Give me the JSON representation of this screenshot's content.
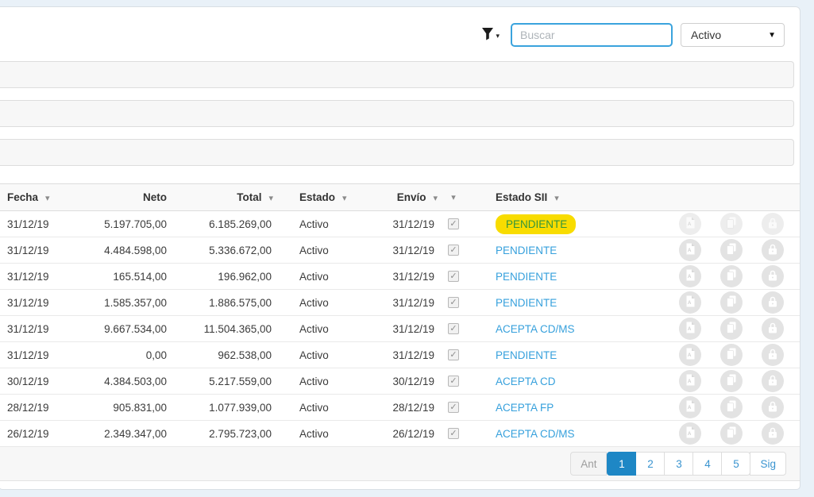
{
  "colors": {
    "accent_blue": "#36a0dc",
    "highlight_bg": "#f8dc00",
    "highlight_text": "#33953c",
    "pagination_active_bg": "#1e87c5",
    "page_background": "#e9f1f8"
  },
  "icons": {
    "sort_caret": "▾",
    "select_caret": "▼",
    "filter_caret": "▾",
    "checkmark": "✓"
  },
  "toolbar": {
    "filter_icon": "funnel-icon",
    "search": {
      "placeholder": "Buscar",
      "value": ""
    },
    "status_select": {
      "selected": "Activo"
    }
  },
  "panels": [
    {
      "label": ""
    },
    {
      "label": ""
    },
    {
      "label": ""
    }
  ],
  "table": {
    "columns": [
      {
        "key": "fecha",
        "label": "Fecha",
        "sortable": true
      },
      {
        "key": "neto",
        "label": "Neto",
        "sortable": false
      },
      {
        "key": "total",
        "label": "Total",
        "sortable": true
      },
      {
        "key": "estado",
        "label": "Estado",
        "sortable": true
      },
      {
        "key": "envio",
        "label": "Envío",
        "sortable": true
      },
      {
        "key": "check",
        "label": "",
        "sortable": true
      },
      {
        "key": "sii",
        "label": "Estado SII",
        "sortable": true
      }
    ],
    "row_actions": [
      "pdf",
      "copy",
      "lock"
    ],
    "rows": [
      {
        "fecha": "31/12/19",
        "neto": "5.197.705,00",
        "total": "6.185.269,00",
        "estado": "Activo",
        "envio": "31/12/19",
        "checked": true,
        "estado_sii": "PENDIENTE",
        "highlight": true,
        "actions_muted": true
      },
      {
        "fecha": "31/12/19",
        "neto": "4.484.598,00",
        "total": "5.336.672,00",
        "estado": "Activo",
        "envio": "31/12/19",
        "checked": true,
        "estado_sii": "PENDIENTE",
        "highlight": false,
        "actions_muted": false
      },
      {
        "fecha": "31/12/19",
        "neto": "165.514,00",
        "total": "196.962,00",
        "estado": "Activo",
        "envio": "31/12/19",
        "checked": true,
        "estado_sii": "PENDIENTE",
        "highlight": false,
        "actions_muted": false
      },
      {
        "fecha": "31/12/19",
        "neto": "1.585.357,00",
        "total": "1.886.575,00",
        "estado": "Activo",
        "envio": "31/12/19",
        "checked": true,
        "estado_sii": "PENDIENTE",
        "highlight": false,
        "actions_muted": false
      },
      {
        "fecha": "31/12/19",
        "neto": "9.667.534,00",
        "total": "11.504.365,00",
        "estado": "Activo",
        "envio": "31/12/19",
        "checked": true,
        "estado_sii": "ACEPTA CD/MS",
        "highlight": false,
        "actions_muted": false
      },
      {
        "fecha": "31/12/19",
        "neto": "0,00",
        "total": "962.538,00",
        "estado": "Activo",
        "envio": "31/12/19",
        "checked": true,
        "estado_sii": "PENDIENTE",
        "highlight": false,
        "actions_muted": false
      },
      {
        "fecha": "30/12/19",
        "neto": "4.384.503,00",
        "total": "5.217.559,00",
        "estado": "Activo",
        "envio": "30/12/19",
        "checked": true,
        "estado_sii": "ACEPTA CD",
        "highlight": false,
        "actions_muted": false
      },
      {
        "fecha": "28/12/19",
        "neto": "905.831,00",
        "total": "1.077.939,00",
        "estado": "Activo",
        "envio": "28/12/19",
        "checked": true,
        "estado_sii": "ACEPTA FP",
        "highlight": false,
        "actions_muted": false
      },
      {
        "fecha": "26/12/19",
        "neto": "2.349.347,00",
        "total": "2.795.723,00",
        "estado": "Activo",
        "envio": "26/12/19",
        "checked": true,
        "estado_sii": "ACEPTA CD/MS",
        "highlight": false,
        "actions_muted": false
      }
    ]
  },
  "pagination": {
    "prev_label": "Ant",
    "next_label": "Sig",
    "pages": [
      "1",
      "2",
      "3",
      "4",
      "5"
    ],
    "active_page": "1"
  }
}
